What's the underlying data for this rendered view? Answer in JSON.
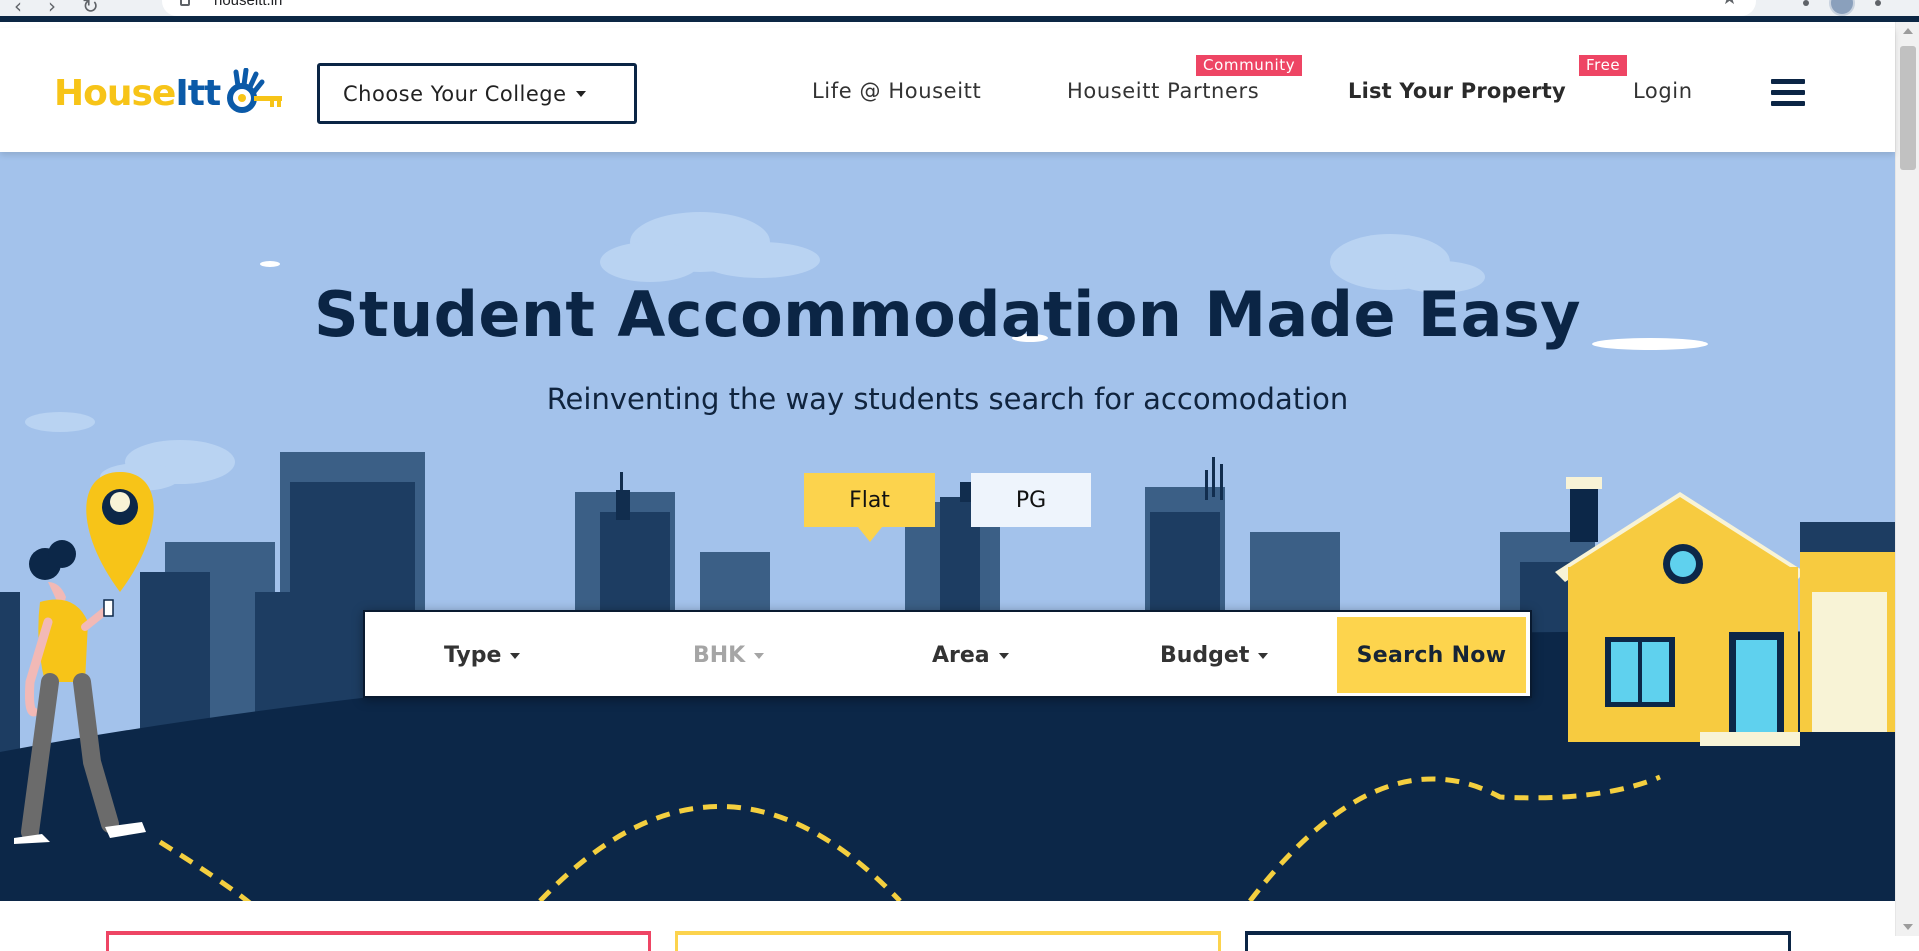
{
  "browser": {
    "url": "houseitt.in",
    "nav_glyphs": "‹›↻",
    "star_glyph": "★"
  },
  "header": {
    "logo": {
      "part1": "House",
      "part2": "Itt"
    },
    "college_dropdown": "Choose Your College",
    "nav": {
      "life": "Life @ Houseitt",
      "partners": "Houseitt Partners",
      "partners_badge": "Community",
      "list_property": "List Your Property",
      "list_badge": "Free",
      "login": "Login"
    }
  },
  "hero": {
    "title": "Student Accommodation Made Easy",
    "subtitle": "Reinventing the way students search for accomodation",
    "tabs": {
      "flat": "Flat",
      "pg": "PG"
    },
    "selected_tab": "Flat"
  },
  "search": {
    "type": "Type",
    "bhk": "BHK",
    "area": "Area",
    "budget": "Budget",
    "button": "Search Now"
  },
  "colors": {
    "navy": "#0b2545",
    "yellow": "#fcd34d",
    "sky": "#a3c2eb",
    "badge": "#ee4564",
    "logo_yellow": "#f7c418",
    "logo_blue": "#0b5aa8"
  },
  "cards": [
    {
      "name": "card-red",
      "color": "#ee4564"
    },
    {
      "name": "card-yellow",
      "color": "#fcd34d"
    },
    {
      "name": "card-navy",
      "color": "#0b2545"
    }
  ]
}
